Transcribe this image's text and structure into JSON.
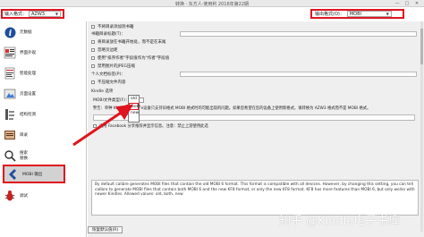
{
  "window": {
    "title": "转换 · 东方人·使用利 2016年第22期",
    "minimize": "—",
    "maximize": "□",
    "close": "✕"
  },
  "input_format": {
    "label": "输入格式：",
    "value": "AZW3"
  },
  "output_format": {
    "label": "输出格式(O)：",
    "value": "MOBI"
  },
  "sidebar": {
    "items": [
      {
        "label": "元数据",
        "icon": "info-icon"
      },
      {
        "label": "界面外观",
        "icon": "look-feel-icon"
      },
      {
        "label": "智能处理",
        "icon": "heuristics-icon"
      },
      {
        "label": "页面设置",
        "icon": "page-setup-icon"
      },
      {
        "label": "结构检测",
        "icon": "structure-icon"
      },
      {
        "label": "目录",
        "icon": "toc-icon"
      },
      {
        "label": "搜索\n替换",
        "icon": "search-replace-icon"
      },
      {
        "label": "MOBI 输出",
        "icon": "mobi-output-icon"
      },
      {
        "label": "调试",
        "icon": "debug-icon"
      }
    ]
  },
  "options": {
    "no_inline_toc": "不将目录添加到书籍",
    "toc_title_label": "书籍目录标题(T)：",
    "toc_at_start": "将目录放在书籍开始处，而不是在末尾",
    "ignore_margins": "忽略页边距",
    "prefer_author_sort": "使用\"排序作者\"字段值作为\"作者\"字段值",
    "no_jpeg_compression": "禁用图片的JPEG压缩",
    "personal_doc_label": "个人文档标签(P)：",
    "dont_compress": "不压缩文件内容"
  },
  "kindle": {
    "section_label": "Kindle 选项",
    "file_type_label": "MOBI文件类型(F)：",
    "file_type_value": "old",
    "file_type_options": [
      "old",
      "both",
      "new"
    ],
    "warning_prefix": "警告：单种 Kindl",
    "warning_text": "e设备只支持旧格式 MOBI 格式时的可能出现的问题。如果您希望在您的设备上使用新格式，请转换为 AZW3 格式而不是 MOBI 格式。",
    "share_label": "启用 Facebook 分享推荐并显示信息。注意：禁止上游使用此选"
  },
  "description": "By default calibre generates MOBI files that contain the old MOBI 6 format. This format is compatible with all devices. However, by changing this setting, you can tell calibre to generate MOBI files that contain both MOBI 6 and the new KF8 format, or only the new KF8 format. KF8 has more features than MOBI 6, but only works with newer Kindles. Allowed values: old, both, new",
  "reset_button": "恢复默认值(R)",
  "watermark": "知乎 @Kindle电子书库"
}
